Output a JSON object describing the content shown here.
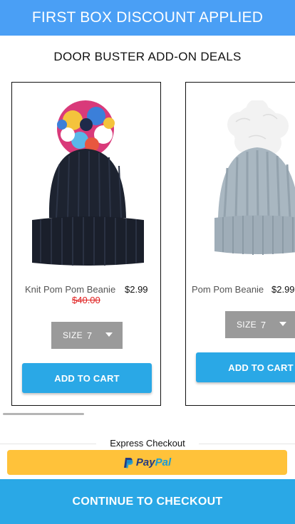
{
  "banner": {
    "text": "FIRST BOX DISCOUNT APPLIED"
  },
  "section": {
    "title": "DOOR BUSTER ADD-ON DEALS"
  },
  "products": [
    {
      "name": "Knit Pom Pom Beanie",
      "price": "$2.99",
      "original_price": "$40.00",
      "size_label": "SIZE",
      "size_value": "7",
      "add_label": "ADD TO CART",
      "hat_color": "#1d2330"
    },
    {
      "name": "Pom Pom Beanie",
      "price": "$2.99",
      "original_price": "",
      "size_label": "SIZE",
      "size_value": "7",
      "add_label": "ADD TO CART",
      "hat_color": "#a9b7c1"
    }
  ],
  "express": {
    "label": "Express Checkout"
  },
  "paypal": {
    "pay": "Pay",
    "pal": "Pal"
  },
  "checkout": {
    "label": "CONTINUE TO CHECKOUT"
  },
  "colors": {
    "banner": "#4a9ff5",
    "button": "#2aa8e6",
    "paypal": "#ffc23a",
    "strike": "#e02020"
  }
}
